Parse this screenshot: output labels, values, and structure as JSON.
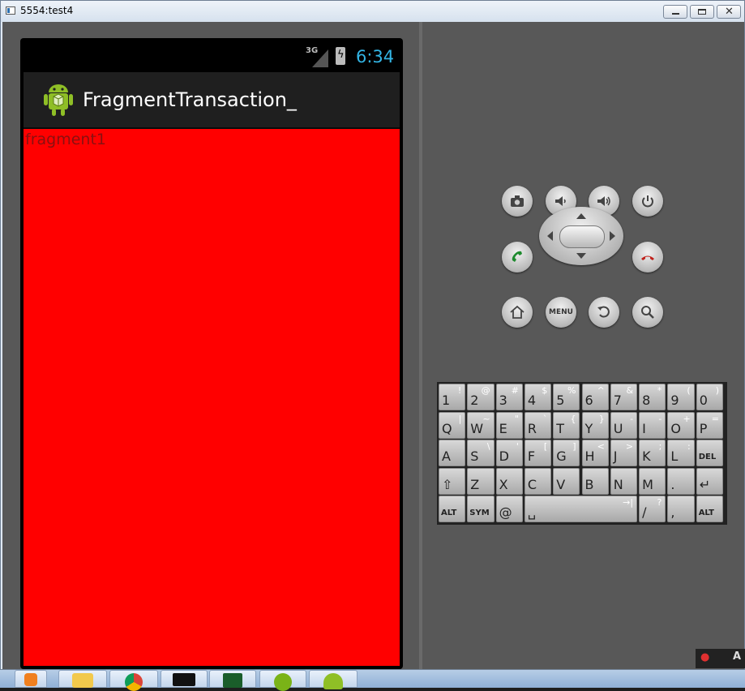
{
  "window": {
    "title": "5554:test4",
    "minimize_icon": "minimize-icon",
    "maximize_icon": "maximize-icon",
    "close_glyph": "✕"
  },
  "device": {
    "status_bar": {
      "network": "3G",
      "time": "6:34"
    },
    "action_bar": {
      "title": "FragmentTransaction_",
      "icon": "android-robot-icon"
    },
    "content": {
      "text": "fragment1",
      "background": "#ff0000"
    }
  },
  "controls": {
    "hardware_buttons": [
      "camera-icon",
      "volume-down-icon",
      "volume-up-icon",
      "power-icon"
    ],
    "call_buttons": [
      "call-icon",
      "end-call-icon"
    ],
    "menu_label": "MENU",
    "nav_buttons": [
      "home-icon",
      "menu-button",
      "back-icon",
      "search-icon"
    ]
  },
  "keyboard": {
    "rows": [
      [
        {
          "m": "1",
          "s": "!"
        },
        {
          "m": "2",
          "s": "@"
        },
        {
          "m": "3",
          "s": "#"
        },
        {
          "m": "4",
          "s": "$"
        },
        {
          "m": "5",
          "s": "%"
        },
        {
          "m": "6",
          "s": "^"
        },
        {
          "m": "7",
          "s": "&"
        },
        {
          "m": "8",
          "s": "*"
        },
        {
          "m": "9",
          "s": "("
        },
        {
          "m": "0",
          "s": ")"
        }
      ],
      [
        {
          "m": "Q",
          "s": "|"
        },
        {
          "m": "W",
          "s": "~"
        },
        {
          "m": "E",
          "s": "\""
        },
        {
          "m": "R",
          "s": "`"
        },
        {
          "m": "T",
          "s": "{"
        },
        {
          "m": "Y",
          "s": "}"
        },
        {
          "m": "U",
          "s": "-"
        },
        {
          "m": "I",
          "s": "-"
        },
        {
          "m": "O",
          "s": "+"
        },
        {
          "m": "P",
          "s": "="
        }
      ],
      [
        {
          "m": "A",
          "s": ""
        },
        {
          "m": "S",
          "s": "\\"
        },
        {
          "m": "D",
          "s": "'"
        },
        {
          "m": "F",
          "s": "["
        },
        {
          "m": "G",
          "s": "]"
        },
        {
          "m": "H",
          "s": "<"
        },
        {
          "m": "J",
          "s": ">"
        },
        {
          "m": "K",
          "s": ";"
        },
        {
          "m": "L",
          "s": ":"
        },
        {
          "m": "DEL",
          "s": ""
        }
      ],
      [
        {
          "m": "⇧",
          "s": ""
        },
        {
          "m": "Z",
          "s": ""
        },
        {
          "m": "X",
          "s": ""
        },
        {
          "m": "C",
          "s": ""
        },
        {
          "m": "V",
          "s": ""
        },
        {
          "m": "B",
          "s": ""
        },
        {
          "m": "N",
          "s": ""
        },
        {
          "m": "M",
          "s": ""
        },
        {
          "m": ".",
          "s": ""
        },
        {
          "m": "↵",
          "s": ""
        }
      ],
      [
        {
          "m": "ALT",
          "s": ""
        },
        {
          "m": "SYM",
          "s": ""
        },
        {
          "m": "@",
          "s": ""
        },
        {
          "m": "␣",
          "s": "→|"
        },
        {
          "m": "/",
          "s": "?"
        },
        {
          "m": ",",
          "s": ""
        },
        {
          "m": "ALT",
          "s": ""
        }
      ]
    ]
  },
  "taskbar": {
    "items": [
      "media-player-icon",
      "file-explorer-icon",
      "chrome-icon",
      "command-prompt-icon",
      "task-manager-icon",
      "code-editor-icon",
      "android-icon"
    ]
  },
  "tray": {
    "text": "A"
  }
}
